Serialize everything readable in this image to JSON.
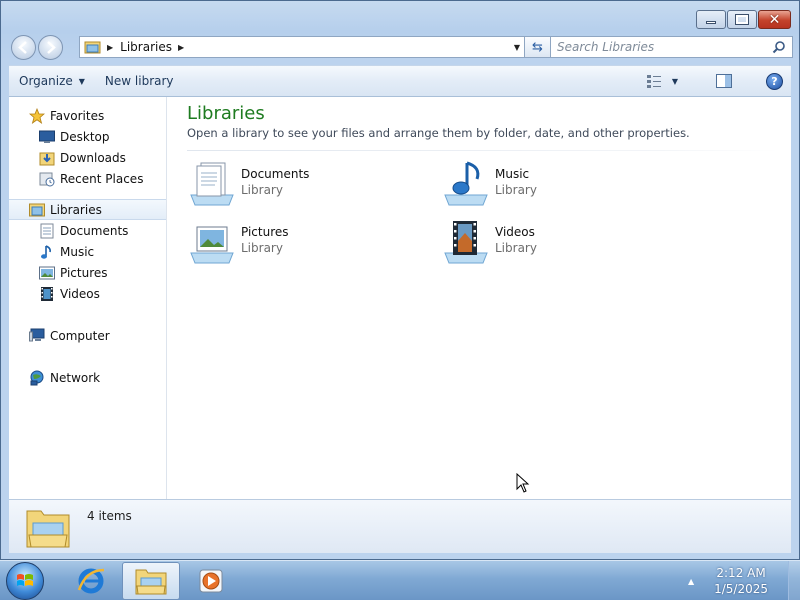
{
  "window": {
    "controls": {
      "minimize_icon": "minimize-icon",
      "maximize_icon": "maximize-icon",
      "close_icon": "close-icon"
    }
  },
  "address": {
    "crumb": "Libraries",
    "search_placeholder": "Search Libraries"
  },
  "command_bar": {
    "organize": "Organize",
    "new_library": "New library"
  },
  "nav_pane": {
    "favorites": {
      "label": "Favorites",
      "items": [
        {
          "label": "Desktop",
          "icon": "desktop-icon"
        },
        {
          "label": "Downloads",
          "icon": "downloads-icon"
        },
        {
          "label": "Recent Places",
          "icon": "recent-places-icon"
        }
      ]
    },
    "libraries": {
      "label": "Libraries",
      "items": [
        {
          "label": "Documents",
          "icon": "documents-icon"
        },
        {
          "label": "Music",
          "icon": "music-icon"
        },
        {
          "label": "Pictures",
          "icon": "pictures-icon"
        },
        {
          "label": "Videos",
          "icon": "videos-icon"
        }
      ]
    },
    "computer": "Computer",
    "network": "Network"
  },
  "main": {
    "title": "Libraries",
    "description": "Open a library to see your files and arrange them by folder, date, and other properties.",
    "libraries": [
      {
        "name": "Documents",
        "type": "Library",
        "icon": "documents-library-icon"
      },
      {
        "name": "Music",
        "type": "Library",
        "icon": "music-library-icon"
      },
      {
        "name": "Pictures",
        "type": "Library",
        "icon": "pictures-library-icon"
      },
      {
        "name": "Videos",
        "type": "Library",
        "icon": "videos-library-icon"
      }
    ]
  },
  "details": {
    "item_count": "4 items"
  },
  "taskbar": {
    "clock_time": "2:12 AM",
    "clock_date": "1/5/2025"
  },
  "colors": {
    "title_green": "#1e7b20",
    "accent_blue": "#1e395b"
  }
}
